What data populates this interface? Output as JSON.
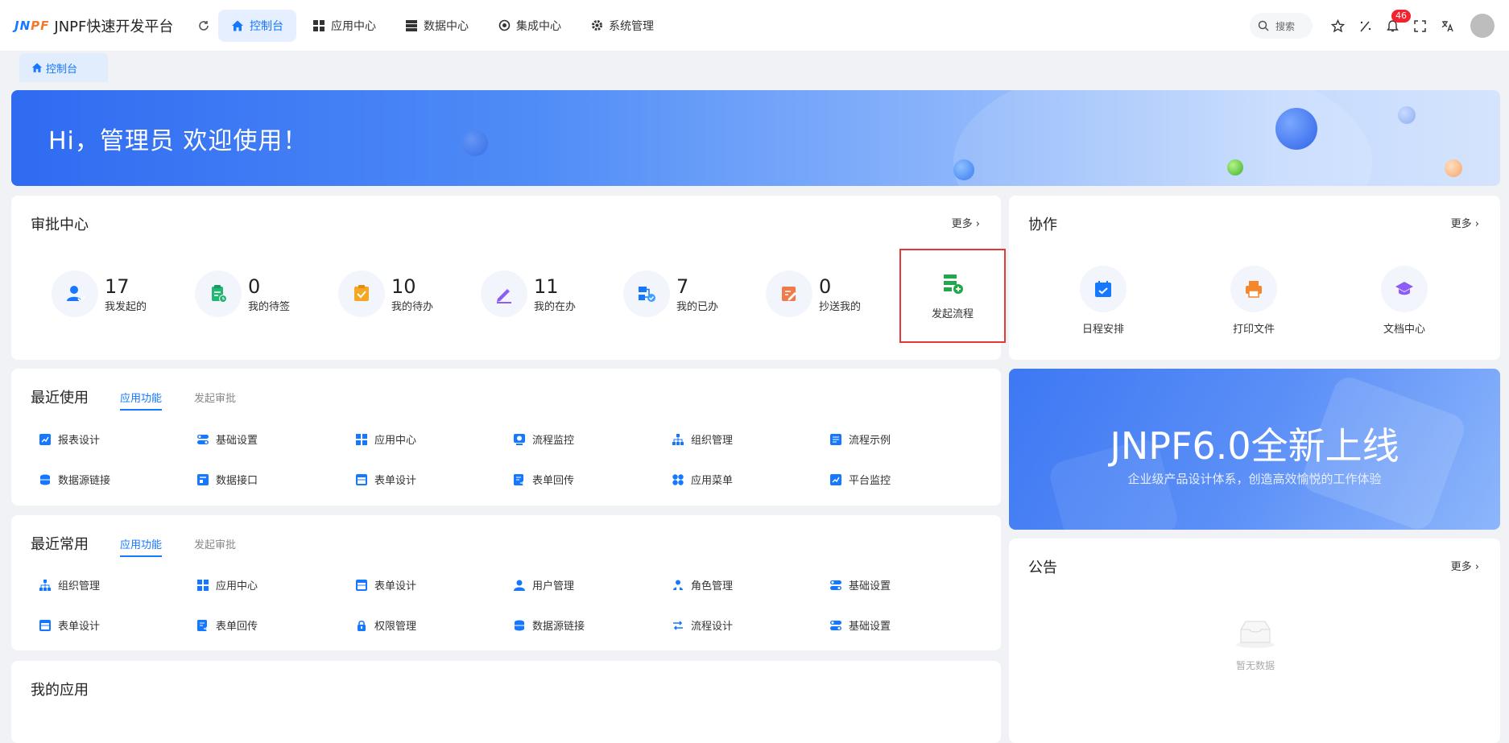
{
  "header": {
    "logo_mark_a": "JN",
    "logo_mark_b": "PF",
    "logo_text": "JNPF快速开发平台",
    "nav": [
      {
        "label": "控制台",
        "icon": "home-icon",
        "active": true
      },
      {
        "label": "应用中心",
        "icon": "grid-icon"
      },
      {
        "label": "数据中心",
        "icon": "database-icon"
      },
      {
        "label": "集成中心",
        "icon": "integration-icon"
      },
      {
        "label": "系统管理",
        "icon": "gear-icon"
      }
    ],
    "search_label": "搜索",
    "notification_count": "46"
  },
  "tabs": [
    {
      "label": "控制台"
    }
  ],
  "banner": {
    "greeting": "Hi，管理员 欢迎使用！"
  },
  "approval": {
    "title": "审批中心",
    "more": "更多",
    "items": [
      {
        "count": "17",
        "label": "我发起的",
        "color": "#1677ff"
      },
      {
        "count": "0",
        "label": "我的待签",
        "color": "#22b573"
      },
      {
        "count": "10",
        "label": "我的待办",
        "color": "#f5a623"
      },
      {
        "count": "11",
        "label": "我的在办",
        "color": "#8e5cf6"
      },
      {
        "count": "7",
        "label": "我的已办",
        "color": "#1677ff"
      },
      {
        "count": "0",
        "label": "抄送我的",
        "color": "#f07a4a"
      }
    ],
    "launch_label": "发起流程"
  },
  "collab": {
    "title": "协作",
    "more": "更多",
    "items": [
      {
        "label": "日程安排",
        "color": "#1677ff"
      },
      {
        "label": "打印文件",
        "color": "#f5862a"
      },
      {
        "label": "文档中心",
        "color": "#8e5cf6"
      }
    ]
  },
  "recent": {
    "title": "最近使用",
    "tabs": [
      "应用功能",
      "发起审批"
    ],
    "items": [
      "报表设计",
      "基础设置",
      "应用中心",
      "流程监控",
      "组织管理",
      "流程示例",
      "数据源链接",
      "数据接口",
      "表单设计",
      "表单回传",
      "应用菜单",
      "平台监控"
    ]
  },
  "frequent": {
    "title": "最近常用",
    "tabs": [
      "应用功能",
      "发起审批"
    ],
    "items": [
      "组织管理",
      "应用中心",
      "表单设计",
      "用户管理",
      "角色管理",
      "基础设置",
      "表单设计",
      "表单回传",
      "权限管理",
      "数据源链接",
      "流程设计",
      "基础设置"
    ]
  },
  "myapps": {
    "title": "我的应用"
  },
  "promo": {
    "title": "JNPF6.0全新上线",
    "subtitle": "企业级产品设计体系，创造高效愉悦的工作体验"
  },
  "notice": {
    "title": "公告",
    "more": "更多",
    "empty": "暂无数据"
  },
  "colors": {
    "accent": "#1677ff",
    "highlight_border": "#e53935",
    "badge": "#f5222d"
  }
}
